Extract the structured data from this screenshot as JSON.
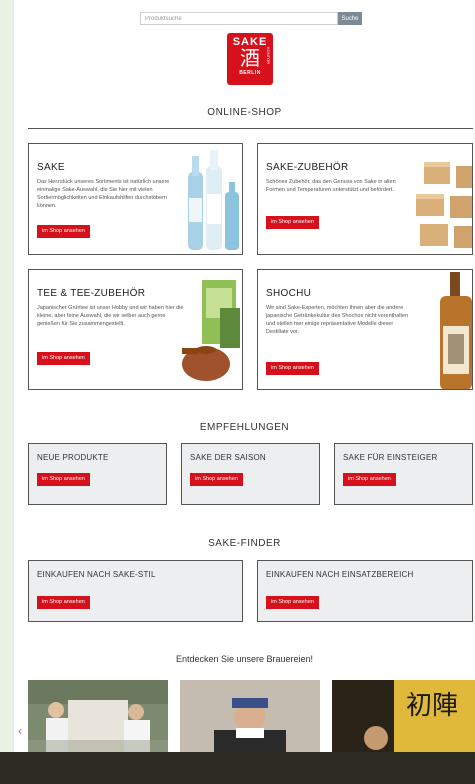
{
  "search": {
    "placeholder": "Produktsuche",
    "button": "Suche"
  },
  "logo": {
    "line1": "SAKE",
    "kanji": "酒",
    "line3": "BERLIN",
    "side": "KONTOR"
  },
  "online_shop": {
    "title": "ONLINE-SHOP",
    "cards": [
      {
        "title": "SAKE",
        "text": "Das Herzstück unseres Sortiments ist natürlich unsere einmalige Sake-Auswahl, die Sie hier mit vielen Sortiermöglichkeiten und Einkaufshilfen durchstöbern können.",
        "button": "im Shop ansehen"
      },
      {
        "title": "SAKE-ZUBEHÖR",
        "text": "Schönes Zubehör, das den Genuss von Sake in allen Formen und Temperaturen unterstützt und befördert.",
        "button": "im Shop ansehen"
      },
      {
        "title": "TEE & TEE-ZUBEHÖR",
        "text": "Japanischer Grüntee ist unser Hobby und wir haben hier die kleine, aber feine Auswahl, die wir selber auch gerne genießen für Sie zusammengestellt.",
        "button": "im Shop ansehen"
      },
      {
        "title": "SHOCHU",
        "text": "Wir sind Sake-Experten, möchten Ihnen aber die andere japanische Getränkekultur des Shochus nicht vorenthalten und stellen hier einige repräsentative Modelle dieser Destillate vor.",
        "button": "im Shop ansehen"
      }
    ]
  },
  "empfehlungen": {
    "title": "EMPFEHLUNGEN",
    "cards": [
      {
        "title": "NEUE PRODUKTE",
        "button": "im Shop ansehen"
      },
      {
        "title": "SAKE DER SAISON",
        "button": "im Shop ansehen"
      },
      {
        "title": "SAKE FÜR EINSTEIGER",
        "button": "im Shop ansehen"
      }
    ]
  },
  "sake_finder": {
    "title": "SAKE-FINDER",
    "cards": [
      {
        "title": "EINKAUFEN NACH SAKE-STIL",
        "button": "im Shop ansehen"
      },
      {
        "title": "EINKAUFEN NACH EINSATZBEREICH",
        "button": "im Shop ansehen"
      }
    ]
  },
  "breweries": {
    "title": "Entdecken Sie unsere Brauereien!",
    "sign_text": "初陣"
  },
  "colors": {
    "accent": "#d7111b",
    "bg": "#e9f1e4"
  }
}
